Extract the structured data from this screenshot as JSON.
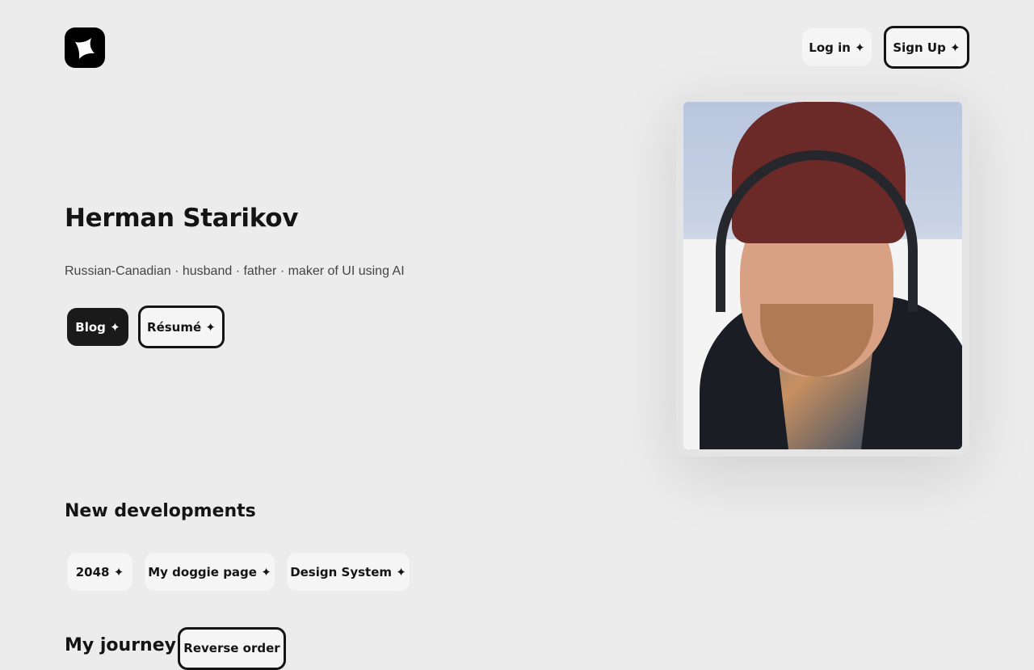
{
  "header": {
    "login_label": "Log in ✦",
    "signup_label": "Sign Up ✦"
  },
  "hero": {
    "name": "Herman Starikov",
    "tagline": "Russian-Canadian · husband · father · maker of UI using AI",
    "blog_label": "Blog ✦",
    "resume_label": "Résumé ✦"
  },
  "developments": {
    "title": "New developments",
    "items": [
      {
        "label": "2048 ✦"
      },
      {
        "label": "My doggie page ✦"
      },
      {
        "label": "Design System ✦"
      }
    ]
  },
  "journey": {
    "title": "My journey",
    "reverse_label": "Reverse order"
  }
}
